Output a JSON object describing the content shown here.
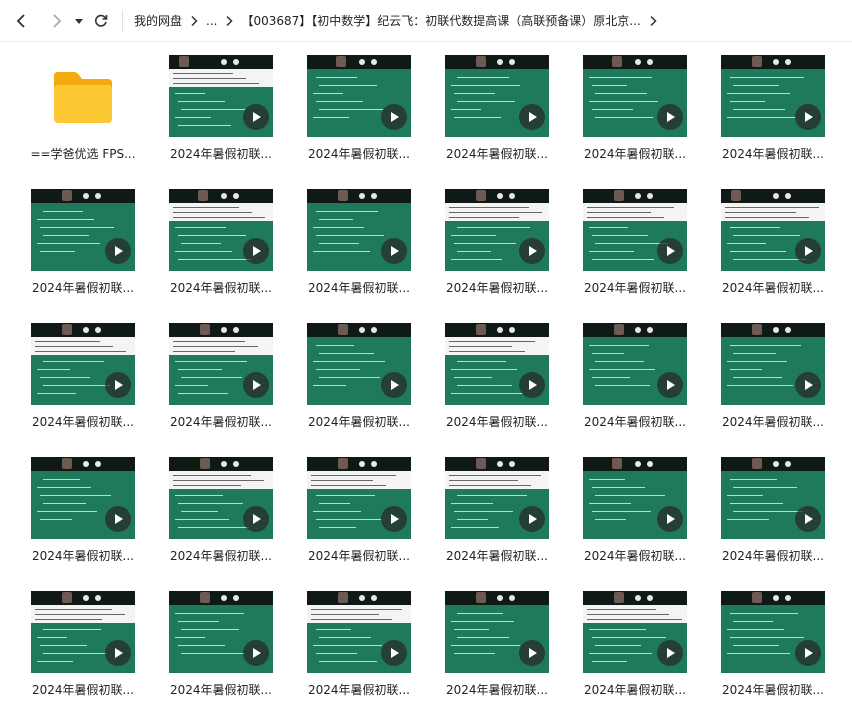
{
  "nav": {
    "back_icon": "chevron-left-icon",
    "forward_icon": "chevron-right-icon",
    "dropdown_icon": "caret-down-icon",
    "refresh_icon": "refresh-icon"
  },
  "breadcrumb": {
    "root": "我的网盘",
    "ellipsis": "...",
    "current": "【003687】【初中数学】纪云飞：初联代数提高课（高联预备课）原北京...",
    "separator_icon": "chevron-right-icon"
  },
  "folder": {
    "name": "==学爸优选 FPS...",
    "icon": "folder-icon",
    "color": "#fbc02d"
  },
  "videos": [
    {
      "name": "2024年暑假初联...",
      "paper": true,
      "cam": 0.1
    },
    {
      "name": "2024年暑假初联...",
      "paper": false,
      "cam": 0.28
    },
    {
      "name": "2024年暑假初联...",
      "paper": false,
      "cam": 0.3
    },
    {
      "name": "2024年暑假初联...",
      "paper": false,
      "cam": 0.28
    },
    {
      "name": "2024年暑假初联...",
      "paper": false,
      "cam": 0.3
    },
    {
      "name": "2024年暑假初联...",
      "paper": false,
      "cam": 0.3
    },
    {
      "name": "2024年暑假初联...",
      "paper": true,
      "cam": 0.28
    },
    {
      "name": "2024年暑假初联...",
      "paper": false,
      "cam": 0.3
    },
    {
      "name": "2024年暑假初联...",
      "paper": true,
      "cam": 0.3
    },
    {
      "name": "2024年暑假初联...",
      "paper": true,
      "cam": 0.3
    },
    {
      "name": "2024年暑假初联...",
      "paper": true,
      "cam": 0.1
    },
    {
      "name": "2024年暑假初联...",
      "paper": true,
      "cam": 0.3
    },
    {
      "name": "2024年暑假初联...",
      "paper": true,
      "cam": 0.3
    },
    {
      "name": "2024年暑假初联...",
      "paper": false,
      "cam": 0.3
    },
    {
      "name": "2024年暑假初联...",
      "paper": true,
      "cam": 0.3
    },
    {
      "name": "2024年暑假初联...",
      "paper": false,
      "cam": 0.3
    },
    {
      "name": "2024年暑假初联...",
      "paper": false,
      "cam": 0.3
    },
    {
      "name": "2024年暑假初联...",
      "paper": false,
      "cam": 0.3
    },
    {
      "name": "2024年暑假初联...",
      "paper": true,
      "cam": 0.3
    },
    {
      "name": "2024年暑假初联...",
      "paper": true,
      "cam": 0.3
    },
    {
      "name": "2024年暑假初联...",
      "paper": true,
      "cam": 0.3
    },
    {
      "name": "2024年暑假初联...",
      "paper": false,
      "cam": 0.28
    },
    {
      "name": "2024年暑假初联...",
      "paper": false,
      "cam": 0.3
    },
    {
      "name": "2024年暑假初联...",
      "paper": true,
      "cam": 0.3
    },
    {
      "name": "2024年暑假初联...",
      "paper": false,
      "cam": 0.3
    },
    {
      "name": "2024年暑假初联...",
      "paper": true,
      "cam": 0.3
    },
    {
      "name": "2024年暑假初联...",
      "paper": false,
      "cam": 0.3
    },
    {
      "name": "2024年暑假初联...",
      "paper": true,
      "cam": 0.3
    },
    {
      "name": "2024年暑假初联...",
      "paper": false,
      "cam": 0.3
    }
  ],
  "colors": {
    "board": "#1e7a5a",
    "strip": "#0f1a17",
    "play_bg": "rgba(40,40,40,0.72)"
  }
}
